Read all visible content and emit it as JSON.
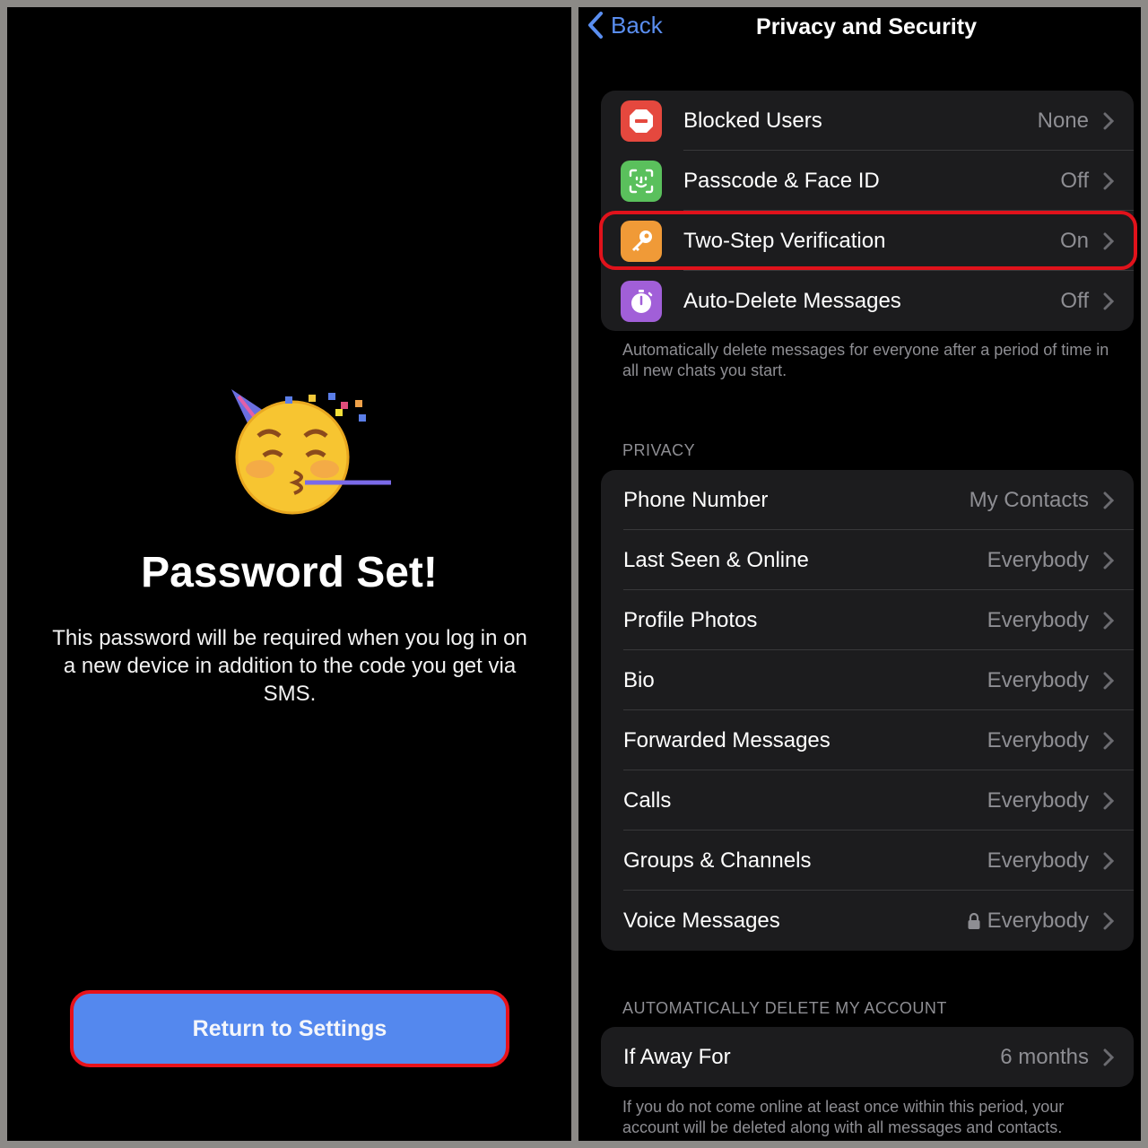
{
  "left": {
    "emoji": "partying-face",
    "title": "Password Set!",
    "description": "This password will be required when you log in on a new device in addition to the code you get via SMS.",
    "button_label": "Return to Settings",
    "highlight_color": "#e8121a",
    "button_color": "#5488ee"
  },
  "right": {
    "back_label": "Back",
    "title": "Privacy and Security",
    "security_items": [
      {
        "label": "Blocked Users",
        "value": "None",
        "icon": "blocked-icon",
        "color": "#e5483e"
      },
      {
        "label": "Passcode & Face ID",
        "value": "Off",
        "icon": "face-id-icon",
        "color": "#5ac05c"
      },
      {
        "label": "Two-Step Verification",
        "value": "On",
        "icon": "key-icon",
        "color": "#f09a37",
        "highlighted": true
      },
      {
        "label": "Auto-Delete Messages",
        "value": "Off",
        "icon": "timer-icon",
        "color": "#a15fd8"
      }
    ],
    "auto_delete_note": "Automatically delete messages for everyone after a period of time in all new chats you start.",
    "privacy_header": "PRIVACY",
    "privacy_items": [
      {
        "label": "Phone Number",
        "value": "My Contacts"
      },
      {
        "label": "Last Seen & Online",
        "value": "Everybody"
      },
      {
        "label": "Profile Photos",
        "value": "Everybody"
      },
      {
        "label": "Bio",
        "value": "Everybody"
      },
      {
        "label": "Forwarded Messages",
        "value": "Everybody"
      },
      {
        "label": "Calls",
        "value": "Everybody"
      },
      {
        "label": "Groups & Channels",
        "value": "Everybody"
      },
      {
        "label": "Voice Messages",
        "value": "Everybody",
        "locked": true
      }
    ],
    "account_header": "AUTOMATICALLY DELETE MY ACCOUNT",
    "account_item": {
      "label": "If Away For",
      "value": "6 months"
    },
    "account_note": "If you do not come online at least once within this period, your account will be deleted along with all messages and contacts."
  }
}
